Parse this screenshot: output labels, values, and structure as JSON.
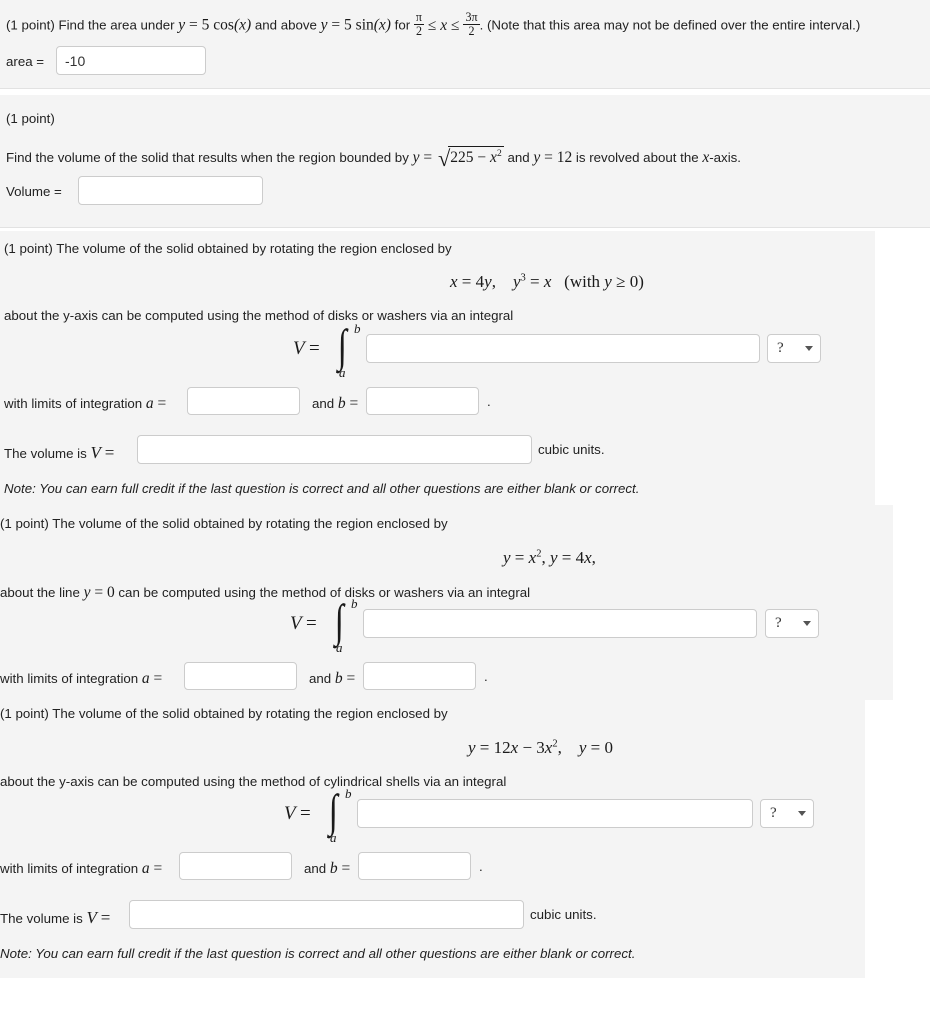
{
  "page": {
    "background": "#ffffff",
    "panel_background": "#f4f4f4",
    "divider_color": "#e2e2e2"
  },
  "problems": [
    {
      "id": "p1",
      "points_label": "(1 point)",
      "prompt_pre": "Find the area under",
      "prompt_mid": "and above",
      "prompt_for": "for",
      "note": "(Note that this area may not be defined over the entire interval.)",
      "equation_1": "y = 5 cos(x)",
      "equation_2": "y = 5 sin(x)",
      "interval_lower": "π/2",
      "interval_upper": "3π/2",
      "answer_label": "area =",
      "answer_value": "-10",
      "answer_placeholder": ""
    },
    {
      "id": "p2",
      "points_label": "(1 point)",
      "prompt": "Find the volume of the solid that results when the region bounded by",
      "equation_1": "y = √(225 − x²)",
      "prompt_and": "and",
      "equation_2": "y = 12",
      "prompt_tail": "is revolved about the x-axis.",
      "answer_label": "Volume =",
      "answer_value": "",
      "answer_placeholder": ""
    },
    {
      "id": "p3",
      "points_label": "(1 point) The volume of the solid obtained by rotating the region enclosed by",
      "display_equation": "x = 4y,   y³ = x   (with y ≥ 0)",
      "method_line": "about the y-axis can be computed using the method of disks or washers via an integral",
      "integral_prefix": "V =",
      "integral_upper": "b",
      "integral_lower": "a",
      "integrand_value": "",
      "integrand_placeholder": "",
      "select_label": "?",
      "limits_prefix": "with limits of integration a =",
      "limit_a_value": "",
      "limits_mid": "and b =",
      "limit_b_value": "",
      "limits_period": ".",
      "volume_label": "The volume is V =",
      "volume_value": "",
      "volume_units": "cubic units.",
      "note": "Note: You can earn full credit if the last question is correct and all other questions are either blank or correct."
    },
    {
      "id": "p4",
      "points_label": "(1 point) The volume of the solid obtained by rotating the region enclosed by",
      "display_equation": "y = x², y = 4x,",
      "method_line_pre": "about the line",
      "method_line_eq": "y = 0",
      "method_line_post": "can be computed using the method of disks or washers via an integral",
      "integral_prefix": "V =",
      "integral_upper": "b",
      "integral_lower": "a",
      "integrand_value": "",
      "integrand_placeholder": "",
      "select_label": "?",
      "limits_prefix": "with limits of integration a =",
      "limit_a_value": "",
      "limits_mid": "and b =",
      "limit_b_value": "",
      "limits_period": "."
    },
    {
      "id": "p5",
      "points_label": "(1 point) The volume of the solid obtained by rotating the region enclosed by",
      "display_equation": "y = 12x − 3x²,   y = 0",
      "method_line": "about the y-axis can be computed using the method of cylindrical shells via an integral",
      "integral_prefix": "V =",
      "integral_upper": "b",
      "integral_lower": "a",
      "integrand_value": "",
      "integrand_placeholder": "",
      "select_label": "?",
      "limits_prefix": "with limits of integration a =",
      "limit_a_value": "",
      "limits_mid": "and b =",
      "limit_b_value": "",
      "limits_period": ".",
      "volume_label": "The volume is V =",
      "volume_value": "",
      "volume_units": "cubic units.",
      "note": "Note: You can earn full credit if the last question is correct and all other questions are either blank or correct."
    }
  ]
}
